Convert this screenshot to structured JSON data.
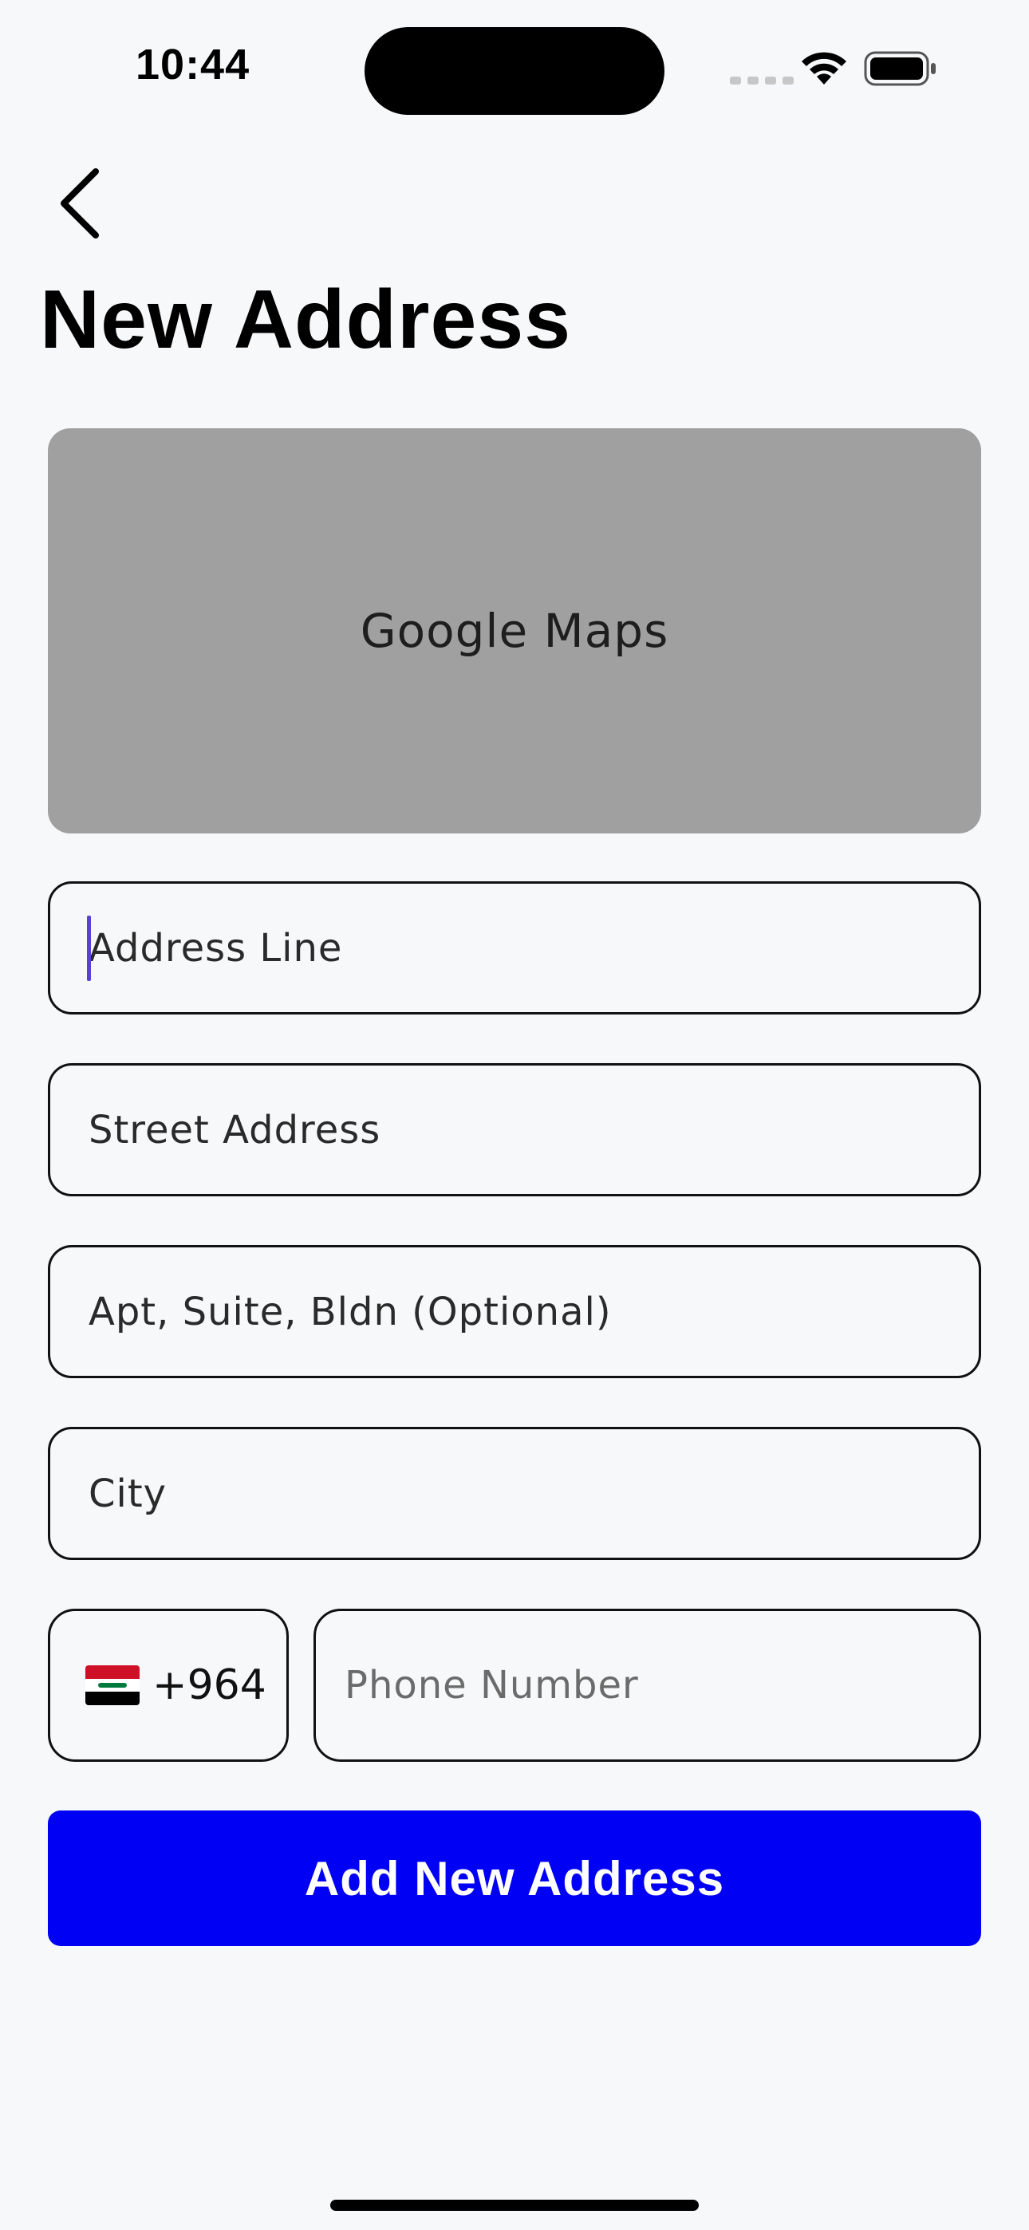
{
  "status_bar": {
    "time": "10:44",
    "icons": [
      "cellular-signal-icon",
      "wifi-icon",
      "battery-icon"
    ]
  },
  "header": {
    "back_icon": "chevron-left-icon",
    "title": "New Address"
  },
  "map": {
    "label": "Google Maps"
  },
  "form": {
    "address_line": {
      "placeholder": "Address Line",
      "value": ""
    },
    "street_address": {
      "placeholder": "Street Address",
      "value": ""
    },
    "apt_suite": {
      "placeholder": "Apt, Suite, Bldn (Optional)",
      "value": ""
    },
    "city": {
      "placeholder": "City",
      "value": ""
    },
    "country_code": {
      "flag": "iraq-flag-icon",
      "dial_code": "+964"
    },
    "phone": {
      "placeholder": "Phone Number",
      "value": ""
    }
  },
  "submit_label": "Add New Address",
  "colors": {
    "background": "#f7f8fa",
    "primary_button": "#0000f5",
    "map_placeholder": "#a0a0a0",
    "cursor": "#5b3fd9"
  }
}
